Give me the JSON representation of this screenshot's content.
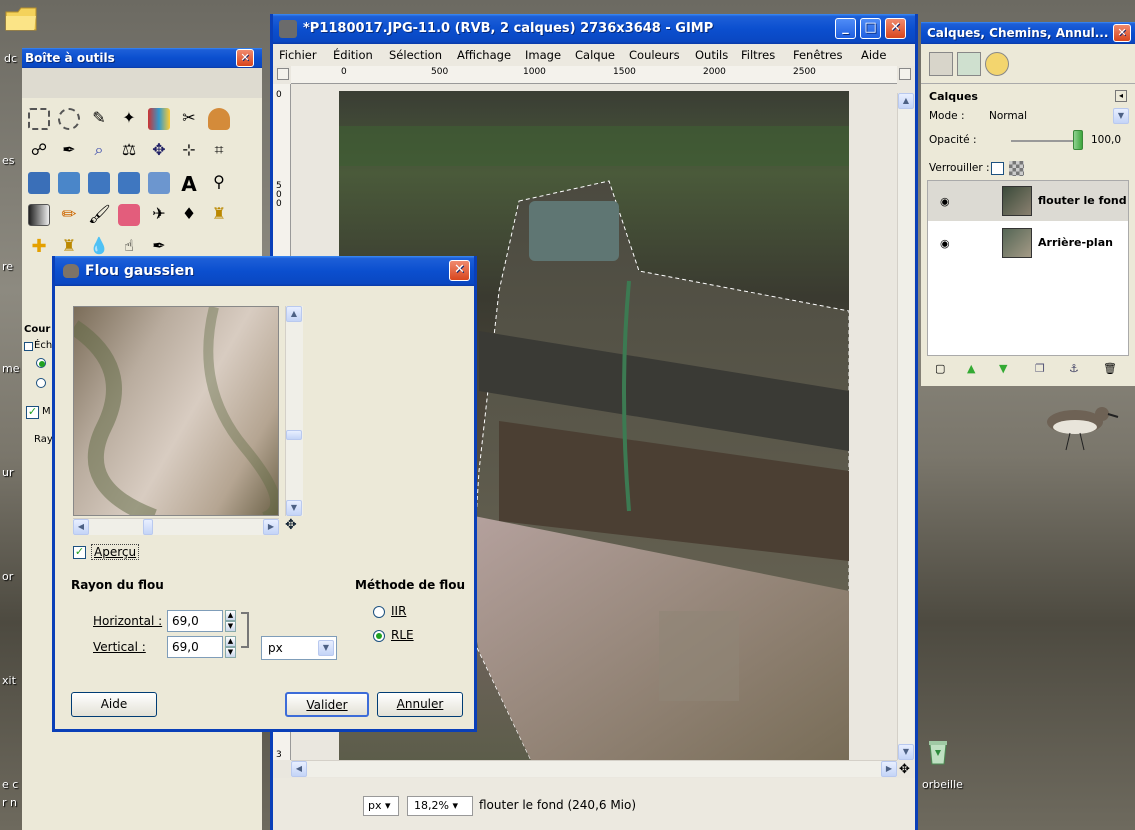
{
  "gimp": {
    "title": "*P1180017.JPG-11.0 (RVB, 2 calques) 2736x3648 - GIMP",
    "menu": [
      "Fichier",
      "Édition",
      "Sélection",
      "Affichage",
      "Image",
      "Calque",
      "Couleurs",
      "Outils",
      "Filtres",
      "Fenêtres",
      "Aide"
    ],
    "ruler_ticks": [
      "0",
      "500",
      "1000",
      "1500",
      "2000",
      "2500"
    ],
    "ruler_v_ticks": [
      "0",
      "500",
      "3"
    ],
    "status": {
      "unit": "px",
      "zoom": "18,2%",
      "info": "flouter le fond (240,6 Mio)"
    }
  },
  "toolbox": {
    "title": "Boîte à outils"
  },
  "layers_dock": {
    "title": "Calques, Chemins, Annul...",
    "section": "Calques",
    "mode_label": "Mode :",
    "mode_value": "Normal",
    "opacity_label": "Opacité :",
    "opacity_value": "100,0",
    "lock_label": "Verrouiller :",
    "layers": [
      {
        "name": "flouter le fond"
      },
      {
        "name": "Arrière-plan"
      }
    ]
  },
  "dialog": {
    "title": "Flou gaussien",
    "preview_label": "Aperçu",
    "radius_heading": "Rayon du flou",
    "horizontal_label": "Horizontal :",
    "horizontal_value": "69,0",
    "vertical_label": "Vertical :",
    "vertical_value": "69,0",
    "unit": "px",
    "method_heading": "Méthode de flou",
    "method_iir": "IIR",
    "method_rle": "RLE",
    "buttons": {
      "help": "Aide",
      "ok": "Valider",
      "cancel": "Annuler"
    }
  },
  "tool_options": {
    "heading": "Cour",
    "scale_label": "Échell",
    "radius_label": "Ray",
    "check_label": "M"
  },
  "desktop": {
    "trash_label": "orbeille",
    "labels": [
      "dc",
      "es",
      "re",
      "me",
      "ur",
      "or",
      "xit",
      "e c",
      "r n"
    ]
  },
  "colors": {
    "xp_blue": "#0a47c2",
    "dialog_bg": "#ece9d8",
    "radio_green": "#21a121"
  }
}
